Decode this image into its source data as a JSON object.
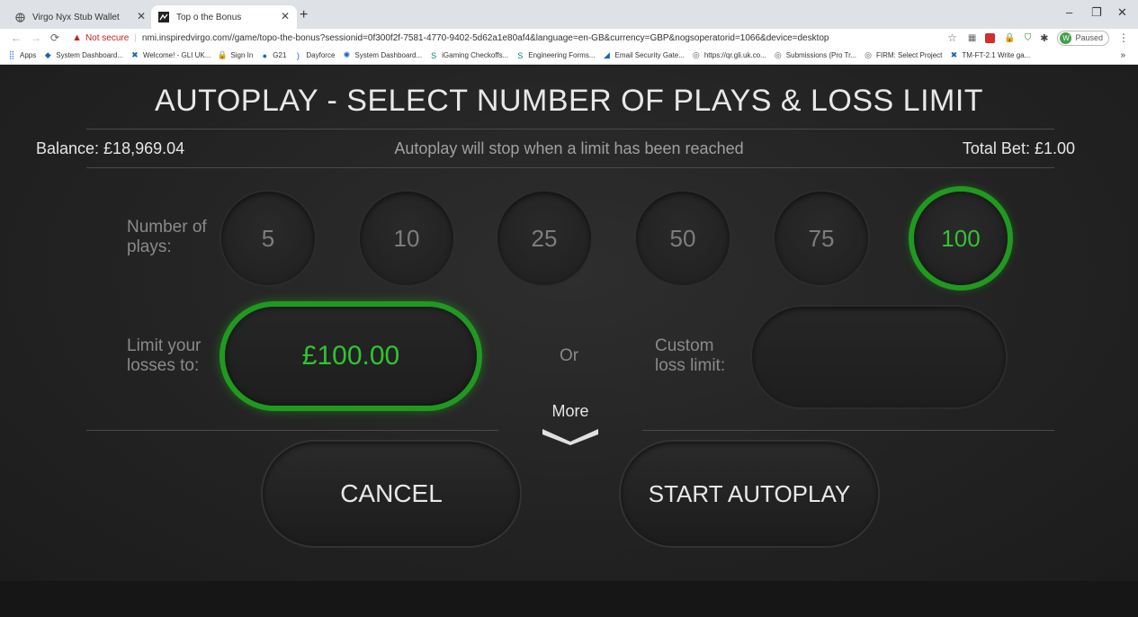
{
  "browser": {
    "tabs": [
      {
        "title": "Virgo Nyx Stub Wallet"
      },
      {
        "title": "Top o the Bonus"
      }
    ],
    "new_tab": "+",
    "security_label": "Not secure",
    "url": "nmi.inspiredvirgo.com//game/topo-the-bonus?sessionid=0f300f2f-7581-4770-9402-5d62a1e80af4&language=en-GB&currency=GBP&nogsoperatorid=1066&device=desktop",
    "profile_badge": "W",
    "profile_status": "Paused",
    "bookmarks": [
      "Apps",
      "System Dashboard...",
      "Welcome! - GLI UK...",
      "Sign In",
      "G21",
      "Dayforce",
      "System Dashboard...",
      "iGaming Checkoffs...",
      "Engineering Forms...",
      "Email Security Gate...",
      "https://qr.gli.uk.co...",
      "Submissions (Pro Tr...",
      "FIRM: Select Project",
      "TM-FT-2.1 Write ga..."
    ],
    "bookmarks_overflow": "»"
  },
  "autoplay": {
    "title": "AUTOPLAY - SELECT NUMBER OF PLAYS & LOSS LIMIT",
    "balance": "Balance: £18,969.04",
    "notice": "Autoplay will stop when a limit has been reached",
    "total_bet": "Total Bet: £1.00",
    "plays_label_1": "Number of",
    "plays_label_2": "plays:",
    "plays_options": [
      "5",
      "10",
      "25",
      "50",
      "75",
      "100"
    ],
    "selected_plays": "100",
    "loss_label_1": "Limit your",
    "loss_label_2": "losses to:",
    "loss_value": "£100.00",
    "or_label": "Or",
    "custom_label_1": "Custom",
    "custom_label_2": "loss limit:",
    "custom_value": "",
    "more_label": "More",
    "cancel_label": "CANCEL",
    "start_label": "START AUTOPLAY"
  },
  "colors": {
    "accent_green": "#1f9a1f",
    "text_green": "#2fc52f"
  }
}
